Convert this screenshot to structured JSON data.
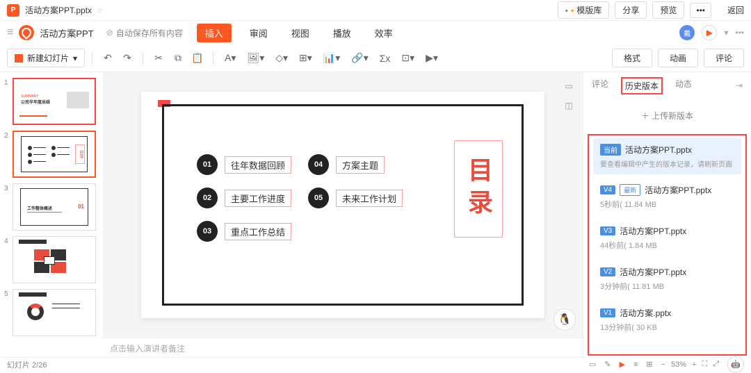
{
  "titlebar": {
    "filename": "活动方案PPT.pptx",
    "template_btn": "模版库",
    "share_btn": "分享",
    "preview_btn": "预览",
    "back_btn": "返回"
  },
  "menubar": {
    "doc_title": "活动方案PPT",
    "autosave": "自动保存所有内容",
    "tabs": [
      "插入",
      "审阅",
      "视图",
      "播放",
      "效率"
    ],
    "avatar_char": "戴"
  },
  "toolbar": {
    "newslide": "新建幻灯片",
    "right_btns": [
      "格式",
      "动画",
      "评论"
    ]
  },
  "thumbs": [
    {
      "num": 1
    },
    {
      "num": 2
    },
    {
      "num": 3
    },
    {
      "num": 4
    },
    {
      "num": 5
    }
  ],
  "thumb_content": {
    "t1_summary": "SUMMARY",
    "t1_title": "公司半年度总结",
    "t2_mulu": "目录",
    "t3_title": "工作整体概述",
    "t3_num": "01"
  },
  "slide": {
    "toc_items_col1": [
      {
        "num": "01",
        "text": "往年数据回顾"
      },
      {
        "num": "02",
        "text": "主要工作进度"
      },
      {
        "num": "03",
        "text": "重点工作总结"
      }
    ],
    "toc_items_col2": [
      {
        "num": "04",
        "text": "方案主题"
      },
      {
        "num": "05",
        "text": "未来工作计划"
      }
    ],
    "toc_title": "目录"
  },
  "notes_placeholder": "点击输入演讲者备注",
  "sidebar": {
    "tabs": [
      "评论",
      "历史版本",
      "动态"
    ],
    "upload_btn": "＋ 上传新版本",
    "versions": [
      {
        "badge": "当前",
        "name": "活动方案PPT.pptx",
        "hint": "要查看编辑中产生的版本记录，请刷新页面",
        "meta": ""
      },
      {
        "badge": "V4",
        "latest": "最新",
        "name": "活动方案PPT.pptx",
        "meta": "5秒前(      11.84 MB"
      },
      {
        "badge": "V3",
        "name": "活动方案PPT.pptx",
        "meta": "44秒前(      1.84 MB"
      },
      {
        "badge": "V2",
        "name": "活动方案PPT.pptx",
        "meta": "3分钟前(      11.81 MB"
      },
      {
        "badge": "V1",
        "name": "活动方案.pptx",
        "meta": "13分钟前(      30 KB"
      }
    ]
  },
  "statusbar": {
    "slide_count": "幻灯片 2/26",
    "zoom": "53%"
  }
}
